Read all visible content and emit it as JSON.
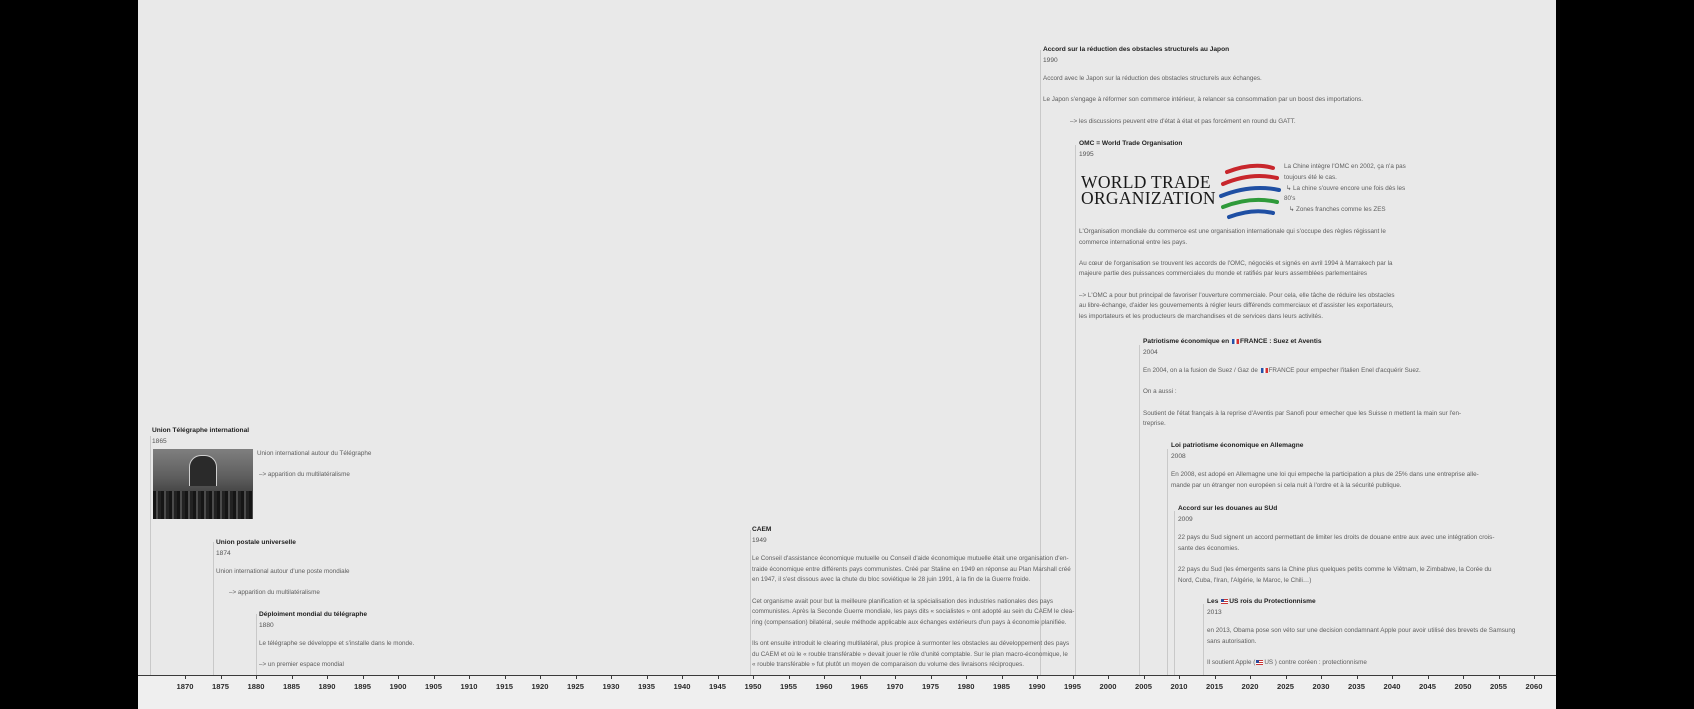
{
  "axis": {
    "ticks": [
      "1870",
      "1875",
      "1880",
      "1885",
      "1890",
      "1895",
      "1900",
      "1905",
      "1910",
      "1915",
      "1920",
      "1925",
      "1930",
      "1935",
      "1940",
      "1945",
      "1950",
      "1955",
      "1960",
      "1965",
      "1970",
      "1975",
      "1980",
      "1985",
      "1990",
      "1995",
      "2000",
      "2005",
      "2010",
      "2015",
      "2020",
      "2025",
      "2030",
      "2035",
      "2040",
      "2045",
      "2050",
      "2055",
      "2060"
    ]
  },
  "events": {
    "telegraphe": {
      "title": "Union Télégraphe international",
      "year": "1865",
      "p1": "Union international autour du Télégraphe",
      "p2": "–> apparition du multilatéralisme"
    },
    "postale": {
      "title": "Union postale universelle",
      "year": "1874",
      "p1": "Union international autour d'une poste mondiale",
      "p2": "–> apparition du multilatéralisme"
    },
    "deploiement": {
      "title": "Déploiment mondial du télégraphe",
      "year": "1880",
      "p1": "Le télégraphe se développe et s'installe dans le monde.",
      "p2": "–> un premier espace mondial"
    },
    "caem": {
      "title": "CAEM",
      "year": "1949",
      "p1a": "Le Conseil d'assistance économique mutuelle ou Conseil d'aide économique mutuelle était une organisation d'en-",
      "p1b": "traide économique entre différents pays communistes. Créé par Staline en 1949 en réponse au Plan Marshall créé",
      "p1c": "en 1947, il s'est dissous avec la chute du bloc soviétique le 28 juin 1991, à la fin de la Guerre froide.",
      "p2a": "Cet organisme avait pour but la meilleure planification et la spécialisation des industries nationales des pays",
      "p2b": "communistes. Après la Seconde Guerre mondiale, les pays dits « socialistes » ont adopté au sein du CAEM le clea-",
      "p2c": "ring (compensation) bilatéral, seule méthode applicable aux échanges extérieurs d'un pays à économie planifiée.",
      "p3a": "Ils ont ensuite introduit le clearing multilatéral, plus propice à surmonter les obstacles au développement des pays",
      "p3b": "du CAEM et où le « rouble transférable » devait jouer le rôle d'unité comptable. Sur le plan macro-économique, le",
      "p3c": "« rouble transférable » fut plutôt un moyen de comparaison du volume des livraisons réciproques."
    },
    "japon": {
      "title": "Accord sur la réduction des obstacles structurels au Japon",
      "year": "1990",
      "p1": "Accord avec le Japon sur la réduction des obstacles structurels aux échanges.",
      "p2": "Le Japon s'engage à réformer son commerce intérieur, à relancer sa consommation par un boost des importations.",
      "p3": "–> les discussions peuvent etre d'état à état et pas forcément en round du GATT."
    },
    "omc": {
      "title": "OMC = World Trade Organisation",
      "year": "1995",
      "logo_line1": "WORLD TRADE",
      "logo_line2": "ORGANIZATION",
      "side1a": "La Chine intègre l'OMC en 2002, ça n'a pas",
      "side1b": "toujours été le cas.",
      "side2a": "↳ La chine s'ouvre encore une fois dès les",
      "side2b": "80's",
      "side3": "↳ Zones franches comme les ZES",
      "p1a": "L'Organisation mondiale du commerce est une organisation internationale qui s'occupe des règles régissant le",
      "p1b": "commerce international entre les pays.",
      "p2a": "Au cœur de l'organisation se trouvent les accords de l'OMC, négociés et signés en avril 1994 à Marrakech par la",
      "p2b": "majeure partie des puissances commerciales du monde et ratifiés par leurs assemblées parlementaires",
      "p3a": "–> L'OMC a pour but principal de favoriser l'ouverture commerciale. Pour cela, elle tâche de réduire les obstacles",
      "p3b": "au libre-échange, d'aider les gouvernements à régler leurs différends commerciaux et d'assister les exportateurs,",
      "p3c": "les importateurs et les producteurs de marchandises et de services dans leurs activités."
    },
    "patriotisme_fr": {
      "title_a": "Patriotisme économique en",
      "title_b": "FRANCE : Suez et Aventis",
      "year": "2004",
      "p1a": "En 2004, on a la fusion de Suez / Gaz de",
      "p1b": "FRANCE pour empecher l'italien Enel d'acquérir Suez.",
      "p2": "On a aussi :",
      "p3a": "Soutient de l'état français à la reprise d'Aventis par Sanofi pour emecher que les Suisse n mettent la main sur l'en-",
      "p3b": "treprise."
    },
    "allemagne": {
      "title": "Loi patriotisme économique en Allemagne",
      "year": "2008",
      "p1a": "En 2008, est adopé en Allemagne une loi qui empeche la participation a plus de 25% dans une entreprise alle-",
      "p1b": "mande par un étranger non européen si cela nuit à l'ordre et à la sécurité publique."
    },
    "sud": {
      "title": "Accord sur les douanes au SUd",
      "year": "2009",
      "p1a": "22 pays du Sud signent un accord permettant de limiter les droits de douane entre aux avec une intégration crois-",
      "p1b": "sante des économies.",
      "p2a": "22 pays du Sud (les émergents sans la Chine plus quelques petits comme le Viêtnam, le Zimbabwe, la Corée du",
      "p2b": "Nord, Cuba, l'Iran, l'Algérie, le Maroc, le Chili…)"
    },
    "us": {
      "title_a": "Les",
      "title_b": "US rois du Protectionnisme",
      "year": "2013",
      "p1a": "en 2013, Obama pose son véto sur une decision condamnant Apple pour avoir utilisé des brevets de Samsung",
      "p1b": "sans autorisation.",
      "p2a": "Il soutient Apple (",
      "p2b": "US ) contre coréen : protectionnisme"
    }
  },
  "colors": {
    "background": "#000000",
    "canvas": "#e9e9e9",
    "wto_red": "#c8262c",
    "wto_blue": "#1f4fa3",
    "wto_green": "#2f9a3a"
  }
}
